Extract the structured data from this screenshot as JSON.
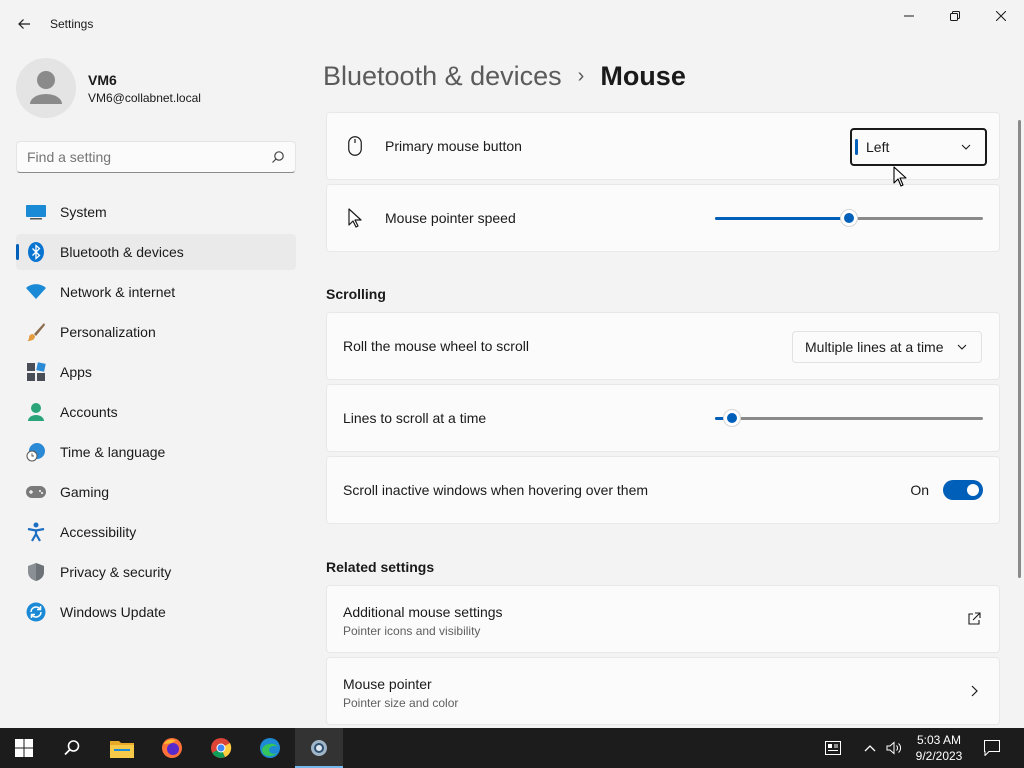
{
  "window": {
    "title": "Settings"
  },
  "profile": {
    "name": "VM6",
    "email": "VM6@collabnet.local"
  },
  "search": {
    "placeholder": "Find a setting"
  },
  "sidebar": {
    "items": [
      {
        "label": "System",
        "icon": "system-icon",
        "active": false
      },
      {
        "label": "Bluetooth & devices",
        "icon": "bluetooth-icon",
        "active": true
      },
      {
        "label": "Network & internet",
        "icon": "wifi-icon",
        "active": false
      },
      {
        "label": "Personalization",
        "icon": "paintbrush-icon",
        "active": false
      },
      {
        "label": "Apps",
        "icon": "apps-icon",
        "active": false
      },
      {
        "label": "Accounts",
        "icon": "person-icon",
        "active": false
      },
      {
        "label": "Time & language",
        "icon": "globe-clock-icon",
        "active": false
      },
      {
        "label": "Gaming",
        "icon": "gamepad-icon",
        "active": false
      },
      {
        "label": "Accessibility",
        "icon": "accessibility-icon",
        "active": false
      },
      {
        "label": "Privacy & security",
        "icon": "shield-icon",
        "active": false
      },
      {
        "label": "Windows Update",
        "icon": "update-icon",
        "active": false
      }
    ]
  },
  "breadcrumb": {
    "parent": "Bluetooth & devices",
    "separator": "›",
    "current": "Mouse"
  },
  "settings": {
    "primary_button": {
      "label": "Primary mouse button",
      "value": "Left"
    },
    "pointer_speed": {
      "label": "Mouse pointer speed",
      "value_fraction": 0.5
    }
  },
  "scrolling": {
    "title": "Scrolling",
    "wheel": {
      "label": "Roll the mouse wheel to scroll",
      "value": "Multiple lines at a time"
    },
    "lines": {
      "label": "Lines to scroll at a time",
      "value_fraction": 0.03
    },
    "inactive": {
      "label": "Scroll inactive windows when hovering over them",
      "state": "On"
    }
  },
  "related": {
    "title": "Related settings",
    "items": [
      {
        "title": "Additional mouse settings",
        "subtitle": "Pointer icons and visibility",
        "action": "open-external-icon"
      },
      {
        "title": "Mouse pointer",
        "subtitle": "Pointer size and color",
        "action": "chevron-right-icon"
      }
    ]
  },
  "taskbar": {
    "time": "5:03 AM",
    "date": "9/2/2023"
  },
  "colors": {
    "accent": "#005fb8",
    "background": "#f3f3f3",
    "card": "#fbfbfb",
    "taskbar": "#1c1c1c"
  }
}
